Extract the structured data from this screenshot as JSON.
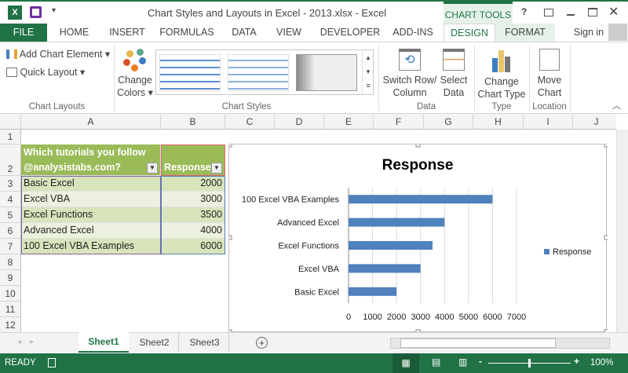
{
  "window": {
    "title": "Chart Styles and Layouts in Excel - 2013.xlsx - Excel",
    "context_tab": "CHART TOOLS",
    "sign_in": "Sign in"
  },
  "tabs": [
    "FILE",
    "HOME",
    "INSERT",
    "FORMULAS",
    "DATA",
    "VIEW",
    "DEVELOPER",
    "ADD-INS",
    "DESIGN",
    "FORMAT"
  ],
  "ribbon": {
    "add_chart_element": "Add Chart Element",
    "quick_layout": "Quick Layout",
    "change_colors_1": "Change",
    "change_colors_2": "Colors",
    "chart_layouts": "Chart Layouts",
    "chart_styles": "Chart Styles",
    "switch_1": "Switch Row/",
    "switch_2": "Column",
    "select_1": "Select",
    "select_2": "Data",
    "data_group": "Data",
    "change_type_1": "Change",
    "change_type_2": "Chart Type",
    "type_group": "Type",
    "move_1": "Move",
    "move_2": "Chart",
    "location_group": "Location"
  },
  "columns": [
    "A",
    "B",
    "C",
    "D",
    "E",
    "F",
    "G",
    "H",
    "I",
    "J"
  ],
  "rows": [
    "1",
    "2",
    "3",
    "4",
    "5",
    "6",
    "7",
    "8",
    "9",
    "10",
    "11",
    "12"
  ],
  "table": {
    "header_a1": "Which tutorials you follow",
    "header_a2": "@analysistabs.com?",
    "header_b": "Response",
    "rows": [
      {
        "name": "Basic Excel",
        "value": "2000"
      },
      {
        "name": "Excel VBA",
        "value": "3000"
      },
      {
        "name": "Excel Functions",
        "value": "3500"
      },
      {
        "name": "Advanced Excel",
        "value": "4000"
      },
      {
        "name": "100 Excel VBA Examples",
        "value": "6000"
      }
    ]
  },
  "chart_data": {
    "type": "bar",
    "title": "Response",
    "categories": [
      "100 Excel VBA Examples",
      "Advanced Excel",
      "Excel Functions",
      "Excel VBA",
      "Basic Excel"
    ],
    "series": [
      {
        "name": "Response",
        "values": [
          6000,
          4000,
          3500,
          3000,
          2000
        ]
      }
    ],
    "xlim": [
      0,
      7000
    ],
    "xticks": [
      "0",
      "1000",
      "2000",
      "3000",
      "4000",
      "5000",
      "6000",
      "7000"
    ],
    "legend": "right",
    "grid": true,
    "color": "#4f81bd"
  },
  "sheets": [
    "Sheet1",
    "Sheet2",
    "Sheet3"
  ],
  "status": {
    "ready": "READY",
    "zoom": "100%"
  }
}
